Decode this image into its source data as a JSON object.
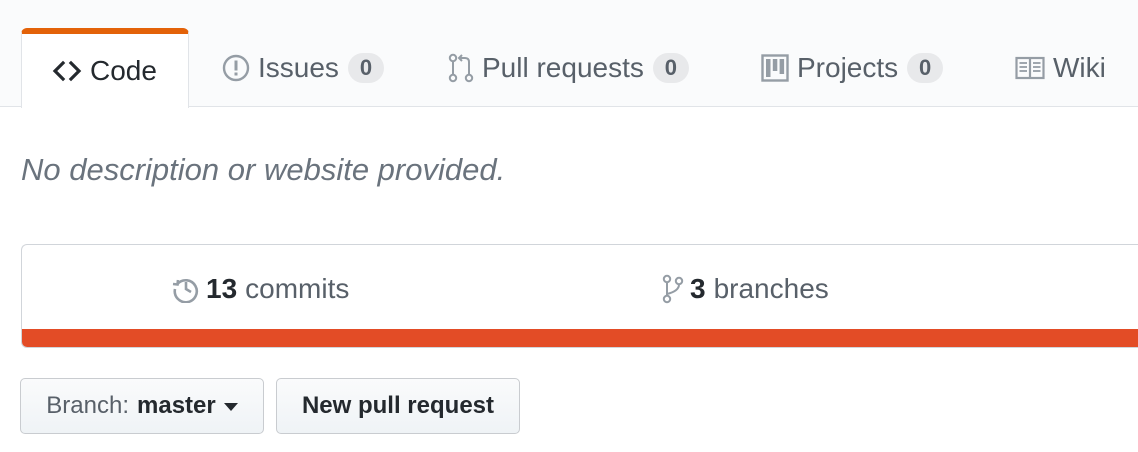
{
  "tabs": [
    {
      "label": "Code",
      "icon": "code-icon",
      "selected": true
    },
    {
      "label": "Issues",
      "icon": "issue-opened-icon",
      "count": "0"
    },
    {
      "label": "Pull requests",
      "icon": "git-pull-request-icon",
      "count": "0"
    },
    {
      "label": "Projects",
      "icon": "project-icon",
      "count": "0"
    },
    {
      "label": "Wiki",
      "icon": "book-icon"
    }
  ],
  "description": "No description or website provided.",
  "summary": {
    "commits": {
      "count": "13",
      "label": "commits",
      "icon": "history-icon"
    },
    "branches": {
      "count": "3",
      "label": "branches",
      "icon": "git-branch-icon"
    },
    "language_color": "#e34c26"
  },
  "branch_select": {
    "prefix": "Branch:",
    "value": "master"
  },
  "new_pull_request_label": "New pull request",
  "colors": {
    "accent": "#e36209",
    "tab_bar_bg": "#fafbfc",
    "border": "#e1e4e8"
  }
}
